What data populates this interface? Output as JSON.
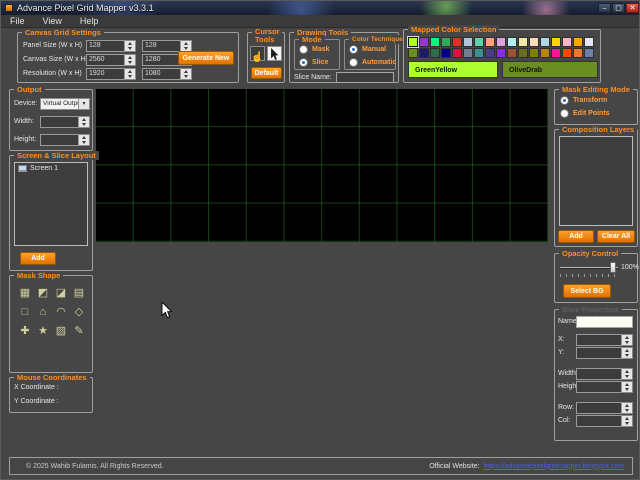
{
  "window": {
    "title": "Advance Pixel Grid Mapper v3.3.1",
    "controls": {
      "minimize": "–",
      "maximize": "▢",
      "close": "✕"
    }
  },
  "menu": {
    "items": [
      "File",
      "View",
      "Help"
    ]
  },
  "canvas_grid_settings": {
    "title": "Canvas  Grid Settings",
    "rows": [
      {
        "label": "Panel Size (W x H)",
        "v1": "128",
        "v2": "128"
      },
      {
        "label": "Canvas Size (W x H)",
        "v1": "2560",
        "v2": "1280"
      },
      {
        "label": "Resolution (W x H)",
        "v1": "1920",
        "v2": "1080"
      }
    ],
    "generate_button": "Generate New"
  },
  "cursor_tools": {
    "title": "Cursor Tools",
    "hand_glyph": "☝",
    "default_button": "Default"
  },
  "drawing_tools": {
    "title": "Drawing Tools",
    "mode": {
      "title": "Mode",
      "options": [
        "Mask",
        "Slice"
      ],
      "selected": "Slice"
    },
    "color_technique": {
      "title": "Color Technique",
      "options": [
        "Manual",
        "Automatic"
      ],
      "selected": "Manual"
    },
    "slice_name_label": "Slice Name:",
    "slice_name_value": ""
  },
  "mapped_colors": {
    "title": "Mapped Color Selection",
    "row1": [
      "#ADFF2F",
      "#9933CC",
      "#00FA7A",
      "#2FAE5A",
      "#E03022",
      "#B0C4DE",
      "#66CDAA",
      "#FFA07A",
      "#DDA0DD",
      "#AFEEEE",
      "#EEE8AA",
      "#FFDAB9",
      "#ADD8E6",
      "#FFD700",
      "#FFB6C1",
      "#FFA500",
      "#E6E6FA"
    ],
    "row2": [
      "#6B8E23",
      "#191970",
      "#2E6B4F",
      "#00008B",
      "#DC143C",
      "#708090",
      "#3A8F8F",
      "#483D8B",
      "#8B2BE2",
      "#A0522D",
      "#6B6B23",
      "#808000",
      "#B8860B",
      "#FF1493",
      "#FF4500",
      "#E87830",
      "#6C7FA6"
    ],
    "primary": {
      "name": "GreenYellow",
      "hex": "#ADFF2F"
    },
    "secondary": {
      "name": "OliveDrab",
      "hex": "#6B8E23"
    }
  },
  "output": {
    "title": "Output",
    "device_label": "Device:",
    "device_value": "Virtual Output",
    "width_label": "Width:",
    "width_value": "",
    "height_label": "Height:",
    "height_value": ""
  },
  "screen_slice_layout": {
    "title": "Screen & Slice Layout",
    "tree_items": [
      "Screen 1"
    ],
    "add_button": "Add"
  },
  "mask_shape": {
    "title": "Mask Shape",
    "shapes": [
      "▦",
      "◩",
      "◪",
      "▤",
      "□",
      "⌂",
      "◠",
      "◇",
      "✚",
      "★",
      "▨",
      "✎"
    ]
  },
  "mouse_coordinates": {
    "title": "Mouse Coordinates",
    "x_label": "X Coordinate :",
    "x_value": "",
    "y_label": "Y Coordinate :",
    "y_value": ""
  },
  "mask_editing_mode": {
    "title": "Mask Editing Mode",
    "options": [
      "Transform",
      "Edit Points"
    ],
    "selected": "Transform"
  },
  "composition_layers": {
    "title": "Composition Layers",
    "add_button": "Add",
    "clear_button": "Clear All"
  },
  "opacity_control": {
    "title": "Opacity Control",
    "value": "100%",
    "select_bg_button": "Select BG"
  },
  "slice_properties": {
    "title": "Slice Properties",
    "name_label": "Name:",
    "name_value": "",
    "fields": [
      {
        "label": "X:",
        "value": ""
      },
      {
        "label": "Y:",
        "value": ""
      },
      {
        "label": "Width:",
        "value": ""
      },
      {
        "label": "Height:",
        "value": ""
      },
      {
        "label": "Row:",
        "value": ""
      },
      {
        "label": "Col:",
        "value": ""
      }
    ]
  },
  "status_bar": {
    "copyright": "© 2025 Wahib Fulamis. All Rights Reserved.",
    "website_label": "Official Website:",
    "website_link": "https://advancepixelgridmapper.blogspot.com"
  }
}
